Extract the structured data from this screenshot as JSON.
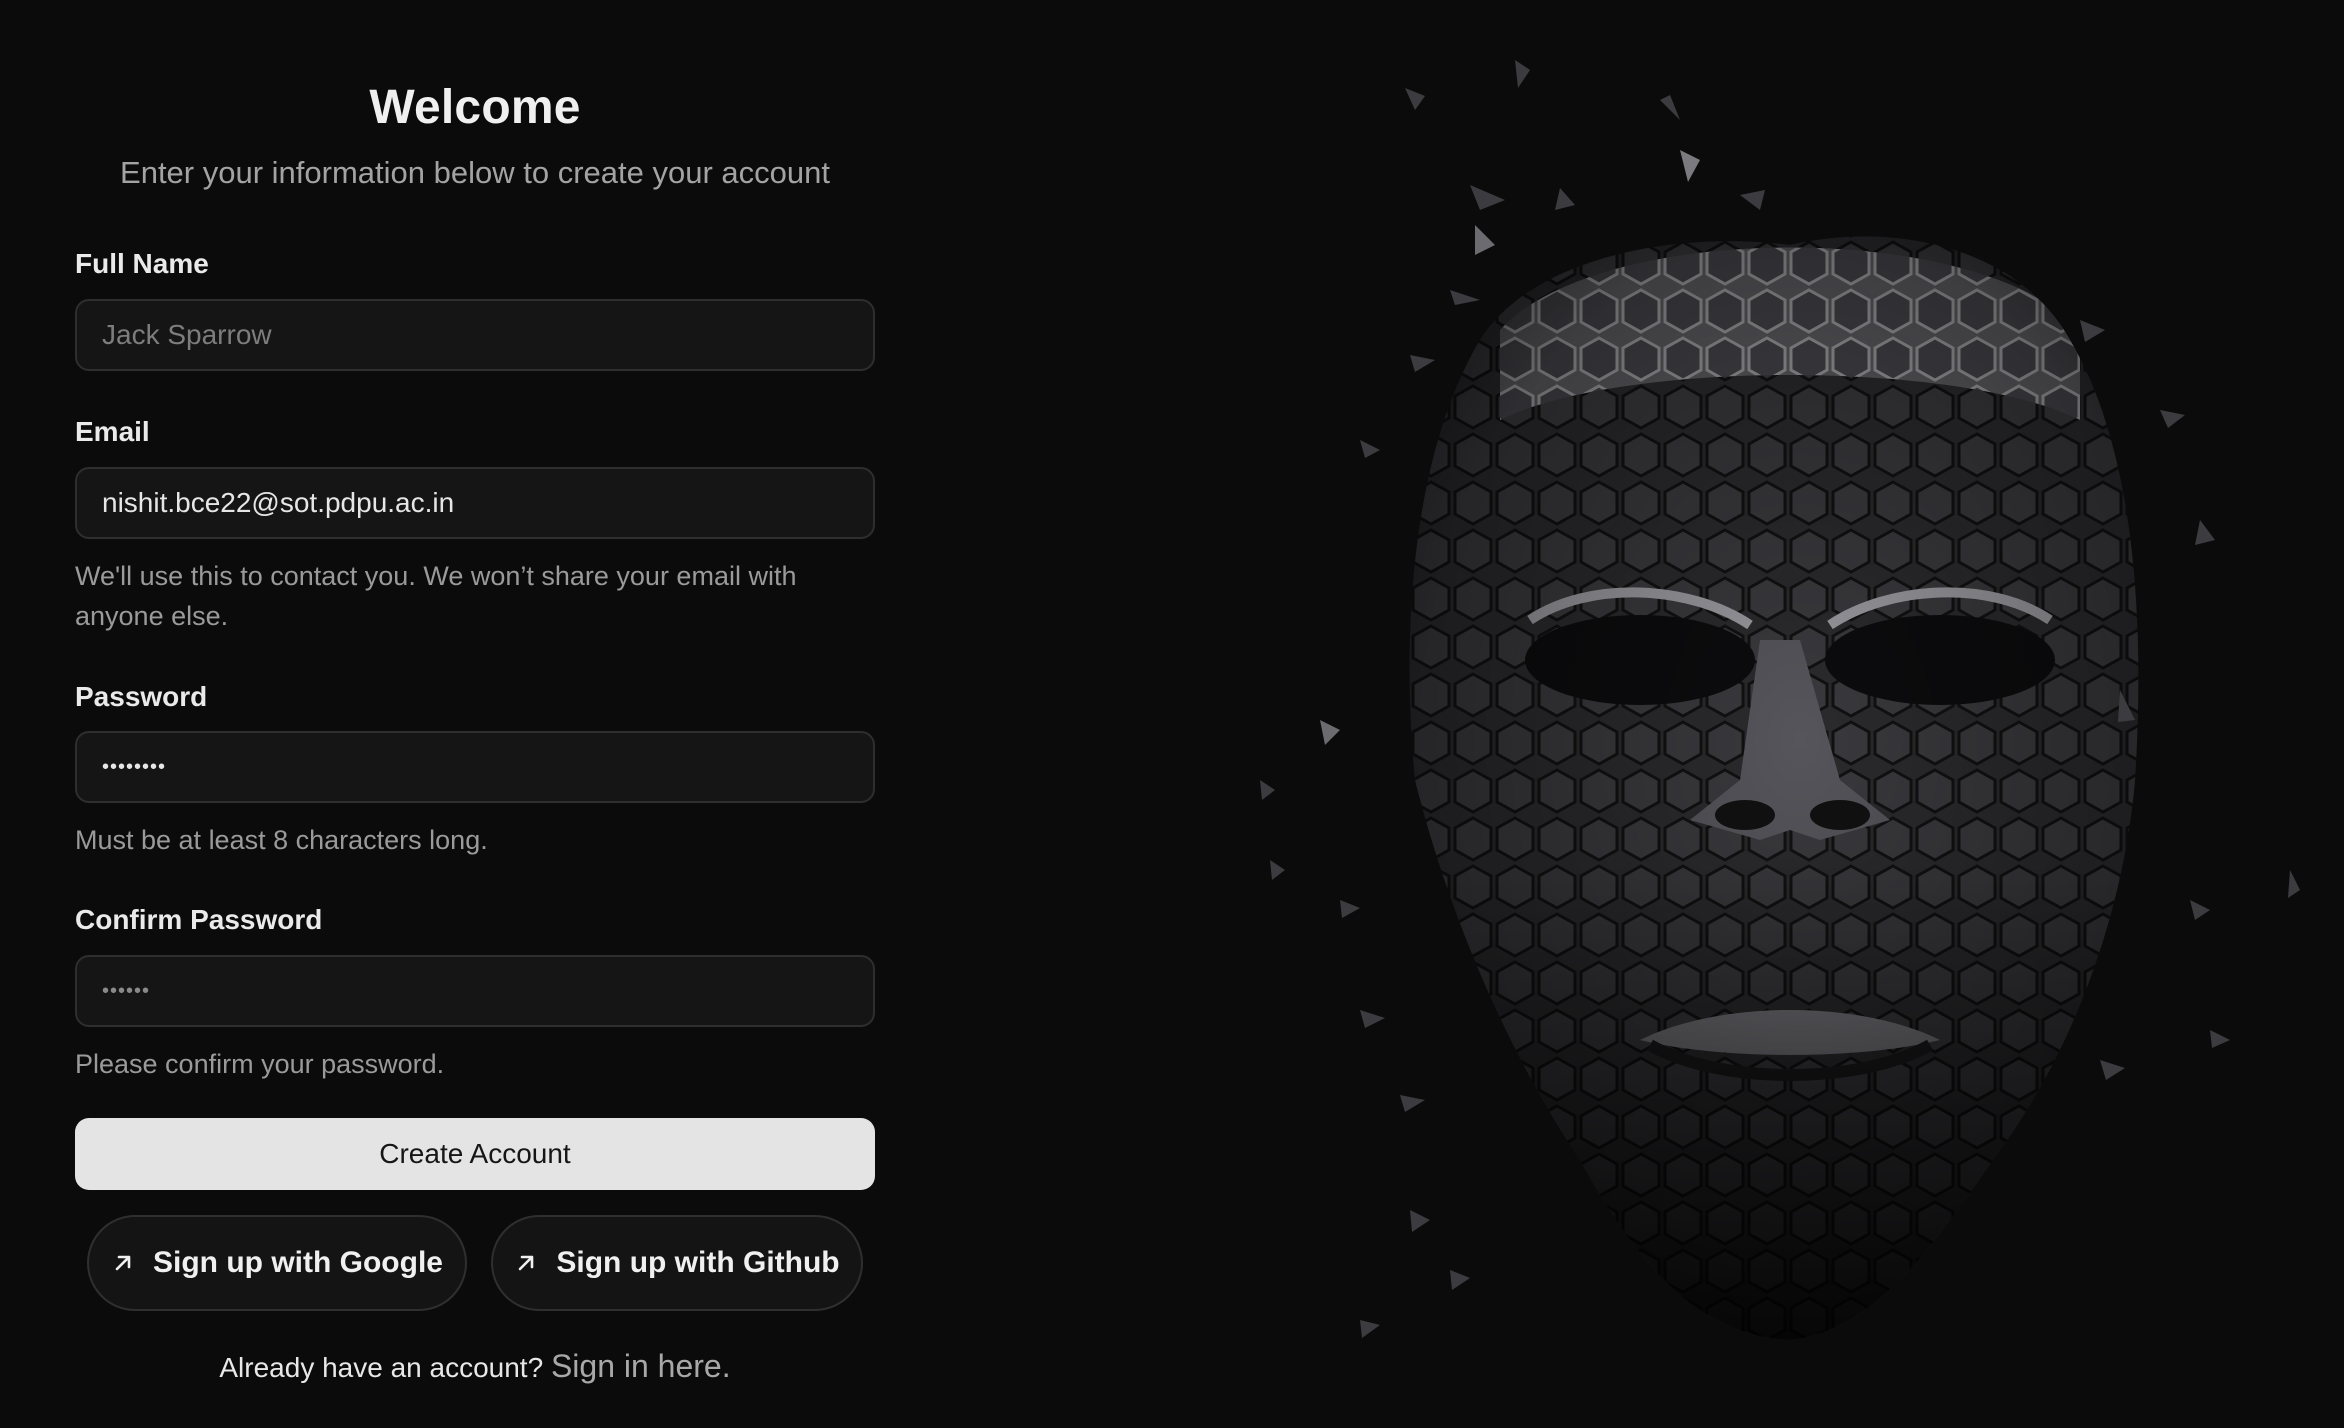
{
  "form": {
    "title": "Welcome",
    "subtitle": "Enter your information below to create your account",
    "full_name": {
      "label": "Full Name",
      "placeholder": "Jack Sparrow",
      "value": ""
    },
    "email": {
      "label": "Email",
      "value": "nishit.bce22@sot.pdpu.ac.in",
      "help": "We'll use this to contact you. We won’t share your email with anyone else."
    },
    "password": {
      "label": "Password",
      "value": "••••••••",
      "help": "Must be at least 8 characters long."
    },
    "confirm_password": {
      "label": "Confirm Password",
      "value": "••••••",
      "help": "Please confirm your password."
    },
    "submit_label": "Create Account",
    "oauth": {
      "google_label": "Sign up with Google",
      "github_label": "Sign up with Github",
      "icon": "arrow-up-right-icon"
    },
    "signin_prompt": "Already have an account?",
    "signin_link": "Sign in here."
  },
  "art": {
    "subject": "faceted-face-illustration-icon"
  },
  "colors": {
    "background": "#0b0b0b",
    "input_bg": "#151515",
    "input_border": "#2e2e2e",
    "primary_button": "#e4e4e4",
    "muted_text": "#9a9a9a"
  }
}
